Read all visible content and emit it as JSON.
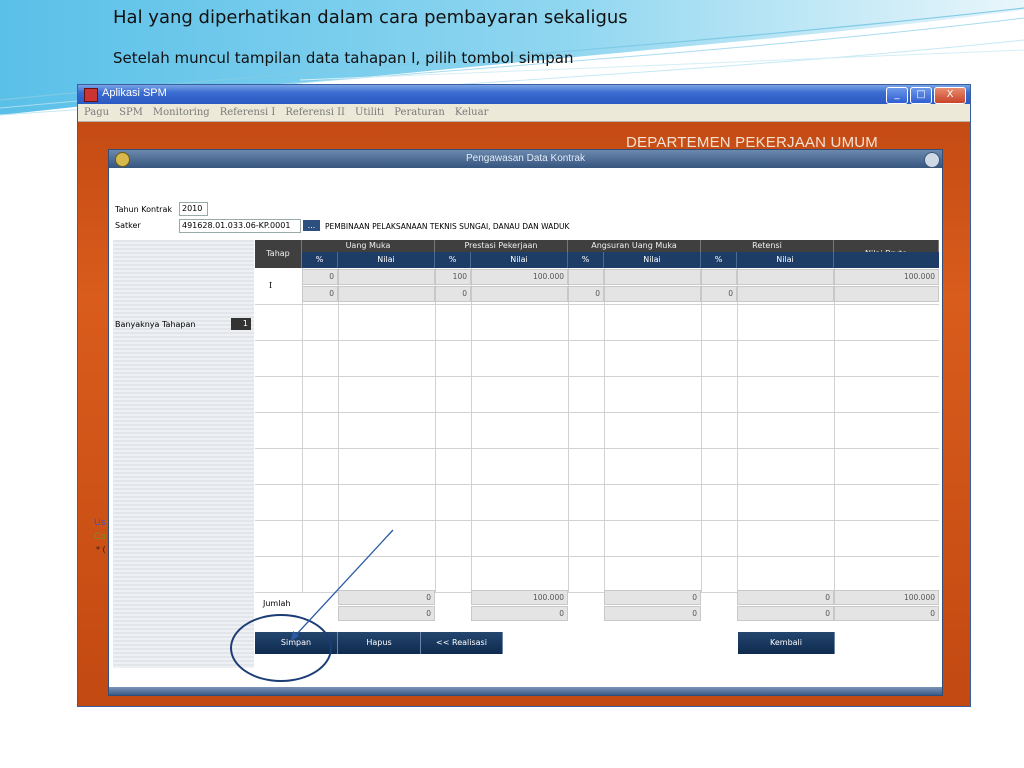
{
  "slide": {
    "title": "Hal yang diperhatikan dalam cara pembayaran sekaligus",
    "subtitle": "Setelah muncul tampilan data tahapan I, pilih tombol simpan"
  },
  "window": {
    "title": "Aplikasi SPM",
    "buttons": {
      "minimize": "_",
      "maximize": "□",
      "close": "X"
    },
    "menu": [
      "Pagu",
      "SPM",
      "Monitoring",
      "Referensi I",
      "Referensi II",
      "Utiliti",
      "Peraturan",
      "Keluar"
    ],
    "banner_text": "DEPARTEMEN PEKERJAAN UMUM",
    "left_fragments": [
      "Us",
      "Co",
      "* ("
    ]
  },
  "dialog": {
    "title": "Pengawasan Data Kontrak",
    "tahun_kontrak_label": "Tahun Kontrak",
    "tahun_kontrak_value": "2010",
    "satker_label": "Satker",
    "satker_code": "491628.01.033.06-KP.0001",
    "satker_lookup": "...",
    "satker_name": "PEMBINAAN PELAKSANAAN TEKNIS SUNGAI, DANAU DAN WADUK",
    "banyaknya_label": "Banyaknya Tahapan",
    "banyaknya_value": "1"
  },
  "table": {
    "col_tahap": "Tahap",
    "groups": [
      "Uang Muka",
      "Prestasi Pekerjaan",
      "Angsuran Uang Muka",
      "Retensi"
    ],
    "col_nilai_bruto": "Nilai Bruto",
    "sub_pct": "%",
    "sub_nilai": "Nilai",
    "rows": [
      {
        "tahap": "I",
        "line1": {
          "um_pct": "0",
          "um_nilai": "",
          "pp_pct": "100",
          "pp_nilai": "100.000",
          "aum_pct": "",
          "aum_nilai": "",
          "ret_pct": "",
          "ret_nilai": "",
          "bruto": "100.000"
        },
        "line2": {
          "um_pct": "0",
          "um_nilai": "",
          "pp_pct": "0",
          "pp_nilai": "",
          "aum_pct": "0",
          "aum_nilai": "",
          "ret_pct": "0",
          "ret_nilai": "",
          "bruto": ""
        }
      }
    ],
    "jumlah_label": "Jumlah",
    "jumlah": {
      "line1": {
        "um": "0",
        "pp": "100.000",
        "aum": "0",
        "ret": "0",
        "bruto": "100.000"
      },
      "line2": {
        "um": "0",
        "pp": "0",
        "aum": "0",
        "ret": "0",
        "bruto": "0"
      }
    }
  },
  "buttons": {
    "simpan": "Simpan",
    "hapus": "Hapus",
    "realisasi": "<< Realisasi",
    "kembali": "Kembali"
  },
  "colors": {
    "banner": "#c44b14",
    "header_dark": "#3f3f3f",
    "header_navy": "#1d3d66",
    "button": "#17355c",
    "callout": "#1b3d75"
  }
}
